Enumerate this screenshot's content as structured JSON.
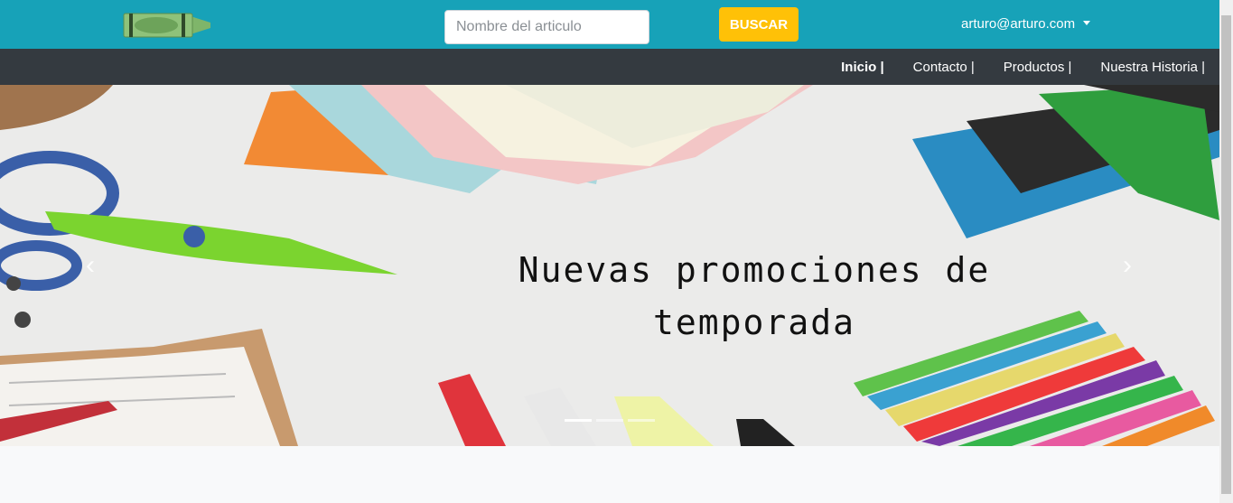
{
  "header": {
    "logo_icon": "crayon-logo-icon",
    "search": {
      "placeholder": "Nombre del articulo",
      "value": ""
    },
    "search_button": "BUSCAR",
    "user_email": "arturo@arturo.com"
  },
  "nav": {
    "items": [
      {
        "label": "Inicio |",
        "active": true
      },
      {
        "label": "Contacto |",
        "active": false
      },
      {
        "label": "Productos |",
        "active": false
      },
      {
        "label": "Nuestra Historia |",
        "active": false
      }
    ]
  },
  "carousel": {
    "caption_line1": "Nuevas promociones de",
    "caption_line2": "temporada",
    "prev_icon": "chevron-left-icon",
    "next_icon": "chevron-right-icon",
    "slides": 3,
    "active_slide": 0
  },
  "colors": {
    "topbar": "#17a2b8",
    "navbar": "#343a40",
    "search_button": "#ffc107",
    "page_background": "#f8f9fa"
  }
}
